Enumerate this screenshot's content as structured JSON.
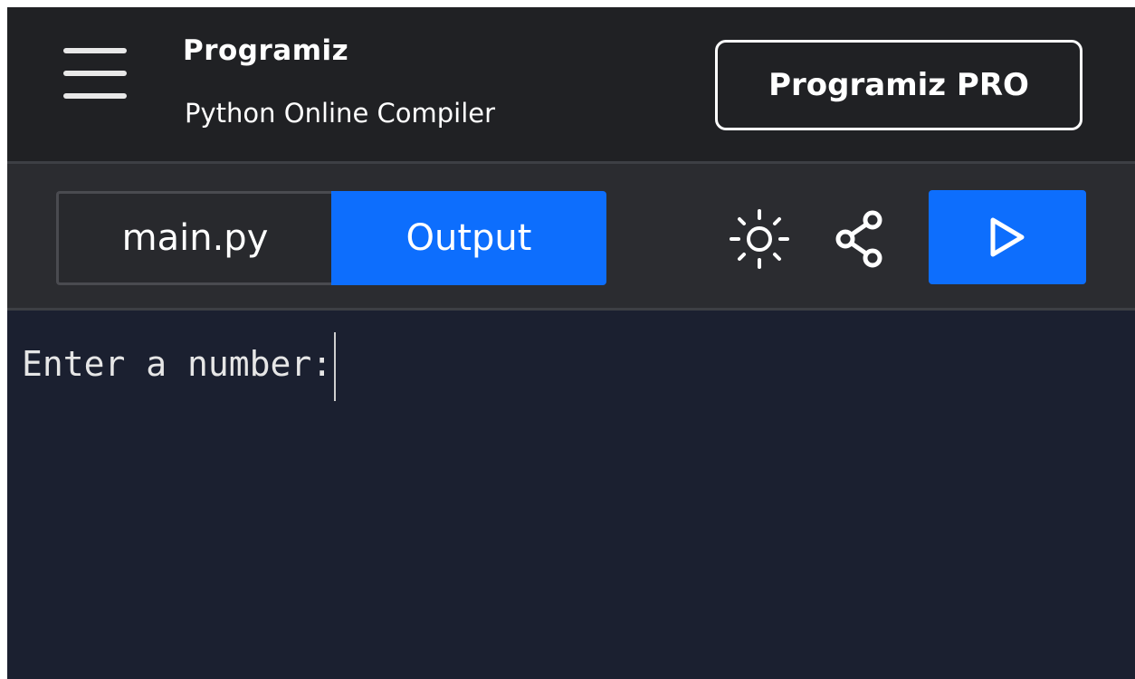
{
  "header": {
    "menu_icon": "hamburger-menu-icon",
    "logo_text": "Programiz",
    "subtitle": "Python Online Compiler",
    "pro_button_label": "Programiz PRO"
  },
  "toolbar": {
    "tabs": [
      {
        "label": "main.py",
        "active": false
      },
      {
        "label": "Output",
        "active": true
      }
    ],
    "theme_icon": "sun-icon",
    "share_icon": "share-icon",
    "run_icon": "play-icon"
  },
  "output": {
    "text": "Enter a number:"
  },
  "colors": {
    "header_bg": "#202124",
    "toolbar_bg": "#2b2c30",
    "output_bg": "#1b2030",
    "accent_blue": "#0d6efd",
    "text": "#ffffff"
  }
}
